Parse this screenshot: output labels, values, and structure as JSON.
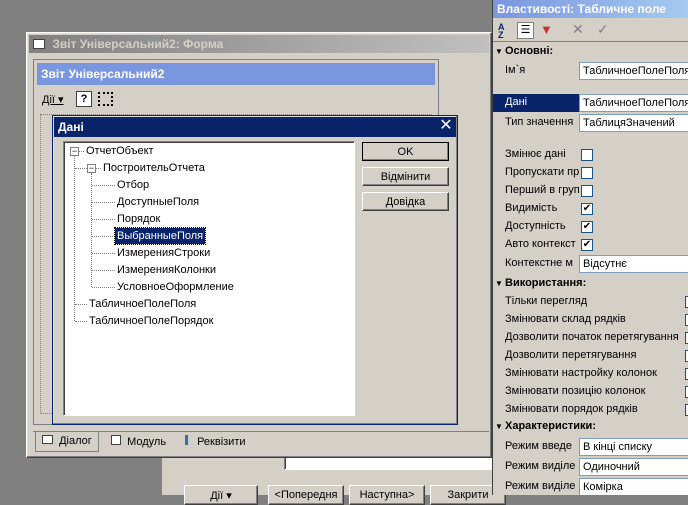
{
  "main_window": {
    "title": "Звіт Універсальний2: Форма",
    "inner_title": "Звіт Універсальний2",
    "toolbar": {
      "actions_menu": "Дії"
    },
    "tabs": [
      {
        "label": "Діалог"
      },
      {
        "label": "Модуль"
      },
      {
        "label": "Реквізити"
      }
    ],
    "bottom_buttons": {
      "actions": "Дії",
      "prev": "<Попередня",
      "next": "Наступна>",
      "close": "Закрити"
    }
  },
  "dialog": {
    "title": "Дані",
    "tree": [
      {
        "label": "ОтчетОбъект",
        "level": 0,
        "expanded": true
      },
      {
        "label": "ПостроительОтчета",
        "level": 1,
        "expanded": true
      },
      {
        "label": "Отбор",
        "level": 2
      },
      {
        "label": "ДоступныеПоля",
        "level": 2
      },
      {
        "label": "Порядок",
        "level": 2
      },
      {
        "label": "ВыбранныеПоля",
        "level": 2,
        "selected": true
      },
      {
        "label": "ИзмеренияСтроки",
        "level": 2
      },
      {
        "label": "ИзмеренияКолонки",
        "level": 2
      },
      {
        "label": "УсловноеОформление",
        "level": 2
      },
      {
        "label": "ТабличноеПолеПоля",
        "level": 1
      },
      {
        "label": "ТабличноеПолеПорядок",
        "level": 1
      }
    ],
    "buttons": {
      "ok": "OK",
      "cancel": "Відмінити",
      "help": "Довідка"
    }
  },
  "properties": {
    "title": "Властивості: Табличне поле",
    "sections": {
      "basic": "Основні:",
      "usage": "Використання:",
      "characteristics": "Характеристики:"
    },
    "basic": {
      "name_label": "Ім`я",
      "name_value": "ТабличноеПолеПоля",
      "data_label": "Дані",
      "data_value": "ТабличноеПолеПоля",
      "value_type_label": "Тип значення",
      "value_type_value": "ТаблицяЗначений"
    },
    "flags": [
      {
        "label": "Змінює дані",
        "checked": false
      },
      {
        "label": "Пропускати пр",
        "checked": false
      },
      {
        "label": "Перший в груп",
        "checked": false
      },
      {
        "label": "Видимість",
        "checked": true
      },
      {
        "label": "Доступність",
        "checked": true
      },
      {
        "label": "Авто контекст",
        "checked": true
      }
    ],
    "context_menu_label": "Контекстне м",
    "context_menu_value": "Відсутнє",
    "usage_items": [
      "Тільки перегляд",
      "Змінювати склад рядків",
      "Дозволити початок перетягування",
      "Дозволити перетягування",
      "Змінювати настройку колонок",
      "Змінювати позицію колонок",
      "Змінювати порядок рядків"
    ],
    "characteristics": [
      {
        "label": "Режим введе",
        "value": "В кінці списку"
      },
      {
        "label": "Режим виділе",
        "value": "Одиночний"
      },
      {
        "label": "Режим виділе",
        "value": "Комірка"
      }
    ],
    "icons": [
      "sort-az-icon",
      "categories-icon",
      "filter-icon",
      "delete-icon",
      "check-icon"
    ]
  }
}
